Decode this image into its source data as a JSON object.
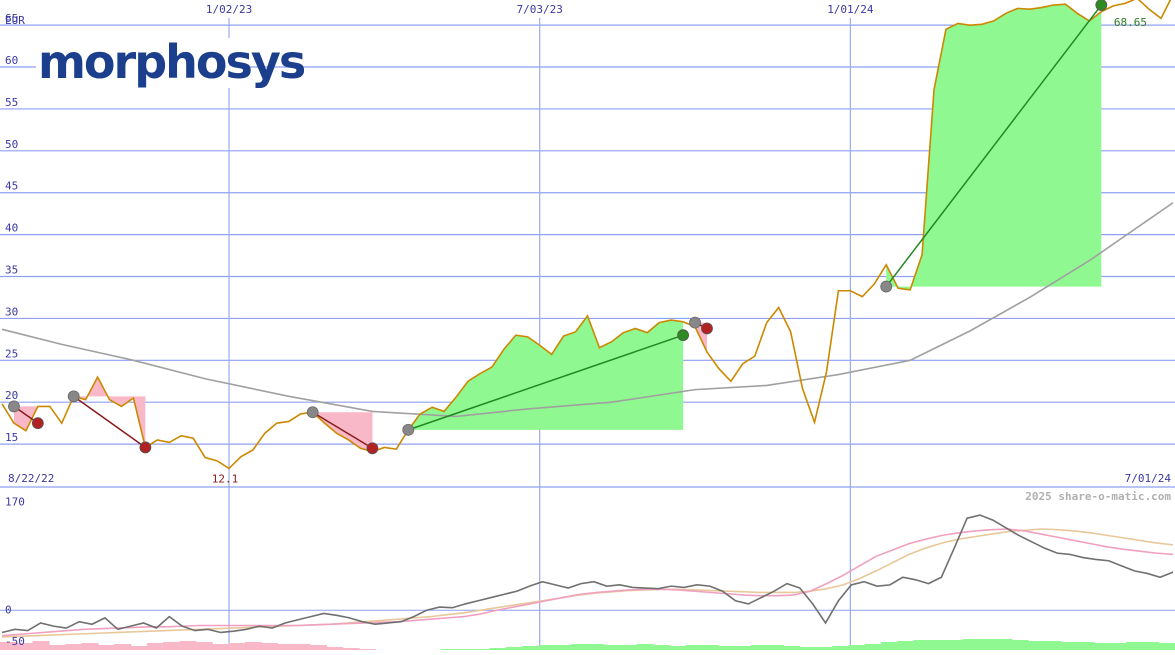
{
  "logo": {
    "text": "morphosys"
  },
  "chart_data": [
    {
      "type": "line",
      "title": "",
      "unit_label": "EUR",
      "ylim": [
        10,
        68
      ],
      "y_ticks": [
        15,
        20,
        25,
        30,
        35,
        40,
        45,
        50,
        55,
        60,
        65
      ],
      "x_top_labels": [
        {
          "label": "1/02/23",
          "date": "2023-01-02"
        },
        {
          "label": "7/03/23",
          "date": "2023-07-03"
        },
        {
          "label": "1/01/24",
          "date": "2024-01-01"
        }
      ],
      "x_range_labels": {
        "start": "8/22/22",
        "end": "7/01/24"
      },
      "x_range": [
        "2022-08-22",
        "2024-07-08"
      ],
      "annotations": {
        "min_label": "12.1",
        "last_label": "68.65"
      },
      "colors": {
        "price": "#cc8800",
        "ma": "#a0a0a0",
        "gain": "#90f890",
        "loss": "#f8b8c8",
        "up_trade": "#228822",
        "down_trade": "#8b1a1a",
        "grid": "#8fa0f0",
        "vertical": "#9aaaf0"
      },
      "series": [
        {
          "name": "",
          "role": "price",
          "points": [
            [
              "2022-08-22",
              19.8
            ],
            [
              "2022-08-29",
              17.5
            ],
            [
              "2022-09-05",
              16.6
            ],
            [
              "2022-09-12",
              19.5
            ],
            [
              "2022-09-19",
              19.5
            ],
            [
              "2022-09-26",
              17.5
            ],
            [
              "2022-10-03",
              20.7
            ],
            [
              "2022-10-10",
              20.3
            ],
            [
              "2022-10-17",
              23.0
            ],
            [
              "2022-10-24",
              20.3
            ],
            [
              "2022-10-31",
              19.5
            ],
            [
              "2022-11-07",
              20.5
            ],
            [
              "2022-11-14",
              14.6
            ],
            [
              "2022-11-21",
              15.5
            ],
            [
              "2022-11-28",
              15.2
            ],
            [
              "2022-12-05",
              16.0
            ],
            [
              "2022-12-12",
              15.7
            ],
            [
              "2022-12-19",
              13.4
            ],
            [
              "2022-12-26",
              13.0
            ],
            [
              "2023-01-02",
              12.1
            ],
            [
              "2023-01-09",
              13.5
            ],
            [
              "2023-01-16",
              14.3
            ],
            [
              "2023-01-23",
              16.3
            ],
            [
              "2023-01-30",
              17.5
            ],
            [
              "2023-02-06",
              17.7
            ],
            [
              "2023-02-13",
              18.6
            ],
            [
              "2023-02-20",
              18.8
            ],
            [
              "2023-02-27",
              17.5
            ],
            [
              "2023-03-06",
              16.3
            ],
            [
              "2023-03-13",
              15.5
            ],
            [
              "2023-03-20",
              14.5
            ],
            [
              "2023-03-27",
              14.1
            ],
            [
              "2023-04-03",
              14.6
            ],
            [
              "2023-04-10",
              14.4
            ],
            [
              "2023-04-17",
              16.7
            ],
            [
              "2023-04-24",
              18.6
            ],
            [
              "2023-05-01",
              19.4
            ],
            [
              "2023-05-08",
              18.9
            ],
            [
              "2023-05-15",
              20.6
            ],
            [
              "2023-05-22",
              22.5
            ],
            [
              "2023-05-29",
              23.4
            ],
            [
              "2023-06-05",
              24.2
            ],
            [
              "2023-06-12",
              26.3
            ],
            [
              "2023-06-19",
              28.0
            ],
            [
              "2023-06-26",
              27.8
            ],
            [
              "2023-07-03",
              26.8
            ],
            [
              "2023-07-10",
              25.7
            ],
            [
              "2023-07-17",
              27.9
            ],
            [
              "2023-07-24",
              28.4
            ],
            [
              "2023-07-31",
              30.3
            ],
            [
              "2023-08-07",
              26.5
            ],
            [
              "2023-08-14",
              27.2
            ],
            [
              "2023-08-21",
              28.3
            ],
            [
              "2023-08-28",
              28.8
            ],
            [
              "2023-09-04",
              28.3
            ],
            [
              "2023-09-11",
              29.5
            ],
            [
              "2023-09-18",
              29.8
            ],
            [
              "2023-09-25",
              29.6
            ],
            [
              "2023-10-02",
              29.0
            ],
            [
              "2023-10-09",
              26.0
            ],
            [
              "2023-10-16",
              24.0
            ],
            [
              "2023-10-23",
              22.5
            ],
            [
              "2023-10-30",
              24.6
            ],
            [
              "2023-11-06",
              25.5
            ],
            [
              "2023-11-13",
              29.5
            ],
            [
              "2023-11-20",
              31.3
            ],
            [
              "2023-11-27",
              28.4
            ],
            [
              "2023-12-04",
              21.6
            ],
            [
              "2023-12-11",
              17.6
            ],
            [
              "2023-12-18",
              23.6
            ],
            [
              "2023-12-25",
              33.3
            ],
            [
              "2024-01-01",
              33.3
            ],
            [
              "2024-01-08",
              32.6
            ],
            [
              "2024-01-15",
              34.1
            ],
            [
              "2024-01-22",
              36.4
            ],
            [
              "2024-01-29",
              33.6
            ],
            [
              "2024-02-05",
              33.4
            ],
            [
              "2024-02-12",
              37.6
            ],
            [
              "2024-02-19",
              57.3
            ],
            [
              "2024-02-26",
              64.5
            ],
            [
              "2024-03-04",
              65.2
            ],
            [
              "2024-03-11",
              65.0
            ],
            [
              "2024-03-18",
              65.1
            ],
            [
              "2024-03-25",
              65.5
            ],
            [
              "2024-04-01",
              66.4
            ],
            [
              "2024-04-08",
              67.0
            ],
            [
              "2024-04-15",
              66.9
            ],
            [
              "2024-04-22",
              67.1
            ],
            [
              "2024-04-29",
              67.4
            ],
            [
              "2024-05-06",
              67.5
            ],
            [
              "2024-05-13",
              66.4
            ],
            [
              "2024-05-20",
              65.5
            ],
            [
              "2024-05-27",
              66.6
            ],
            [
              "2024-06-03",
              67.3
            ],
            [
              "2024-06-10",
              67.6
            ],
            [
              "2024-06-17",
              68.2
            ],
            [
              "2024-06-24",
              66.9
            ],
            [
              "2024-07-01",
              65.8
            ],
            [
              "2024-07-08",
              68.65
            ]
          ]
        },
        {
          "name": "",
          "role": "moving-average",
          "points": [
            [
              "2022-08-22",
              28.7
            ],
            [
              "2022-09-26",
              26.9
            ],
            [
              "2022-11-07",
              25.0
            ],
            [
              "2022-12-19",
              22.8
            ],
            [
              "2023-02-06",
              20.7
            ],
            [
              "2023-03-27",
              18.9
            ],
            [
              "2023-05-15",
              18.3
            ],
            [
              "2023-06-26",
              19.2
            ],
            [
              "2023-08-14",
              20.0
            ],
            [
              "2023-10-02",
              21.5
            ],
            [
              "2023-11-13",
              22.0
            ],
            [
              "2023-12-25",
              23.3
            ],
            [
              "2024-02-05",
              25.0
            ],
            [
              "2024-03-11",
              28.5
            ],
            [
              "2024-04-15",
              32.5
            ],
            [
              "2024-05-20",
              36.9
            ],
            [
              "2024-07-08",
              43.8
            ]
          ]
        }
      ],
      "trades": [
        {
          "direction": "down",
          "entry": [
            "2022-08-29",
            19.5
          ],
          "exit": [
            "2022-09-12",
            17.5
          ]
        },
        {
          "direction": "down",
          "entry": [
            "2022-10-03",
            20.7
          ],
          "exit": [
            "2022-11-14",
            14.6
          ]
        },
        {
          "direction": "down",
          "entry": [
            "2023-02-20",
            18.8
          ],
          "exit": [
            "2023-03-27",
            14.5
          ]
        },
        {
          "direction": "up",
          "entry": [
            "2023-04-17",
            16.7
          ],
          "exit": [
            "2023-09-25",
            28.0
          ]
        },
        {
          "direction": "down",
          "entry": [
            "2023-10-02",
            29.5
          ],
          "exit": [
            "2023-10-09",
            28.8
          ]
        },
        {
          "direction": "up",
          "entry": [
            "2024-01-22",
            33.8
          ],
          "exit": [
            "2024-05-27",
            67.4
          ]
        }
      ]
    },
    {
      "type": "line",
      "title": "",
      "ylim": [
        -50,
        180
      ],
      "y_ticks": [
        -50,
        0,
        170
      ],
      "watermark": "2025 share-o-matic.com",
      "colors": {
        "momentum": "#707070",
        "signal_fast": "#f0a0c0",
        "signal_slow": "#e8c89a",
        "hist_pos": "#90f890",
        "hist_neg": "#f8b8c8"
      },
      "series": [
        {
          "name": "",
          "role": "momentum",
          "values": [
            -35,
            -30,
            -32,
            -20,
            -25,
            -28,
            -18,
            -22,
            -12,
            -30,
            -25,
            -20,
            -28,
            -10,
            -25,
            -32,
            -30,
            -35,
            -33,
            -30,
            -25,
            -28,
            -20,
            -15,
            -10,
            -5,
            -8,
            -12,
            -18,
            -22,
            -20,
            -18,
            -10,
            0,
            5,
            4,
            10,
            15,
            20,
            25,
            30,
            38,
            45,
            40,
            35,
            42,
            45,
            38,
            40,
            36,
            35,
            34,
            38,
            36,
            40,
            38,
            30,
            15,
            10,
            20,
            30,
            42,
            35,
            10,
            -20,
            15,
            40,
            45,
            38,
            40,
            52,
            48,
            42,
            52,
            98,
            145,
            150,
            142,
            130,
            118,
            108,
            98,
            90,
            88,
            83,
            80,
            78,
            70,
            62,
            58,
            52,
            60
          ]
        },
        {
          "name": "",
          "role": "signal-fast",
          "values": [
            -40,
            -38,
            -36,
            -34,
            -32,
            -30,
            -29,
            -28,
            -27,
            -26,
            -26,
            -25,
            -24,
            -24,
            -24,
            -24,
            -24,
            -24,
            -24,
            -23,
            -22,
            -21,
            -20,
            -19,
            -18,
            -16,
            -14,
            -12,
            -10,
            -6,
            0,
            5,
            10,
            15,
            20,
            25,
            28,
            30,
            32,
            33,
            33,
            32,
            30,
            28,
            26,
            24,
            23,
            23,
            24,
            30,
            42,
            55,
            70,
            85,
            95,
            105,
            112,
            118,
            122,
            125,
            127,
            128,
            125,
            120,
            115,
            110,
            105,
            100,
            96,
            93,
            90,
            88
          ]
        },
        {
          "name": "",
          "role": "signal-slow",
          "values": [
            -42,
            -41,
            -40,
            -39,
            -38,
            -37,
            -36,
            -35,
            -34,
            -33,
            -32,
            -31,
            -30,
            -29,
            -28,
            -27,
            -26,
            -25,
            -24,
            -23,
            -22,
            -20,
            -18,
            -16,
            -14,
            -12,
            -10,
            -7,
            -4,
            0,
            4,
            8,
            12,
            16,
            20,
            24,
            27,
            29,
            31,
            32,
            33,
            33,
            32,
            31,
            30,
            29,
            28,
            28,
            28,
            30,
            34,
            40,
            50,
            62,
            75,
            88,
            98,
            106,
            112,
            116,
            120,
            124,
            126,
            128,
            127,
            125,
            122,
            118,
            114,
            110,
            106,
            103
          ]
        },
        {
          "name": "",
          "role": "histogram",
          "values": [
            -8,
            -7,
            -9,
            -5,
            -6,
            -7,
            -5,
            -6,
            -4,
            -7,
            -8,
            -9,
            -8,
            -6,
            -7,
            -8,
            -7,
            -6,
            -6,
            -5,
            -3,
            -2,
            -1,
            0,
            0,
            0,
            0,
            1,
            1,
            1,
            2,
            3,
            4,
            5,
            5,
            6,
            6,
            5,
            5,
            6,
            5,
            4,
            5,
            5,
            4,
            4,
            5,
            5,
            4,
            3,
            3,
            4,
            5,
            6,
            8,
            9,
            10,
            10,
            10,
            11,
            11,
            11,
            10,
            9,
            9,
            8,
            8,
            7,
            7,
            8,
            8,
            7
          ]
        }
      ]
    }
  ]
}
